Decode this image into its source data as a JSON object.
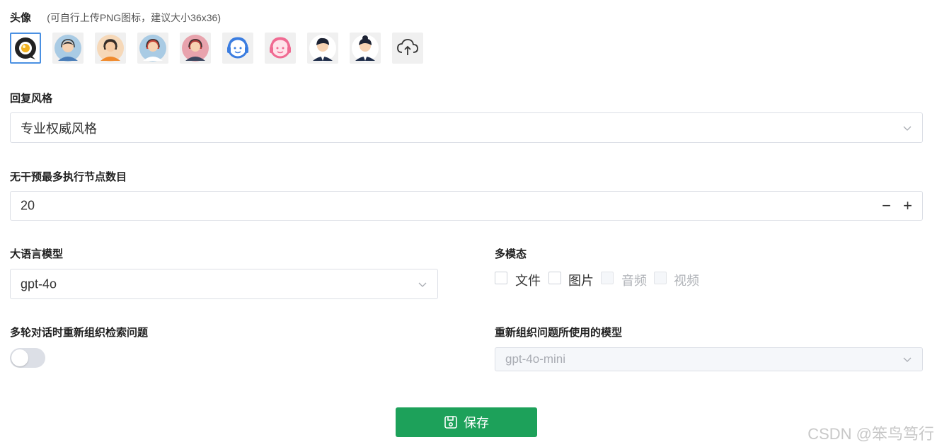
{
  "avatar_section": {
    "label": "头像",
    "hint": "(可自行上传PNG图标，建议大小36x36)",
    "avatars": [
      {
        "icon": "chat-bubble-logo-icon",
        "selected": true
      },
      {
        "icon": "agent-male-headset-icon"
      },
      {
        "icon": "agent-female-headset-icon"
      },
      {
        "icon": "agent-female-redhair-icon"
      },
      {
        "icon": "agent-female-pink-icon"
      },
      {
        "icon": "agent-blue-headset-icon"
      },
      {
        "icon": "agent-pink-headset-icon"
      },
      {
        "icon": "agent-male-suit-icon"
      },
      {
        "icon": "agent-female-suit-icon"
      },
      {
        "icon": "cloud-upload-icon"
      }
    ]
  },
  "reply_style": {
    "label": "回复风格",
    "value": "专业权威风格"
  },
  "max_nodes": {
    "label": "无干预最多执行节点数目",
    "value": "20",
    "minus": "−",
    "plus": "+"
  },
  "llm": {
    "label": "大语言模型",
    "value": "gpt-4o"
  },
  "multimodal": {
    "label": "多模态",
    "options": [
      {
        "label": "文件",
        "disabled": false
      },
      {
        "label": "图片",
        "disabled": false
      },
      {
        "label": "音频",
        "disabled": true
      },
      {
        "label": "视频",
        "disabled": true
      }
    ]
  },
  "rewrite": {
    "label": "多轮对话时重新组织检索问题",
    "enabled": false
  },
  "rewrite_model": {
    "label": "重新组织问题所使用的模型",
    "value": "gpt-4o-mini"
  },
  "save_button": {
    "label": "保存"
  },
  "watermark": "CSDN @笨鸟笃行",
  "colors": {
    "accent": "#1da15a",
    "selected_border": "#4a90e2"
  }
}
